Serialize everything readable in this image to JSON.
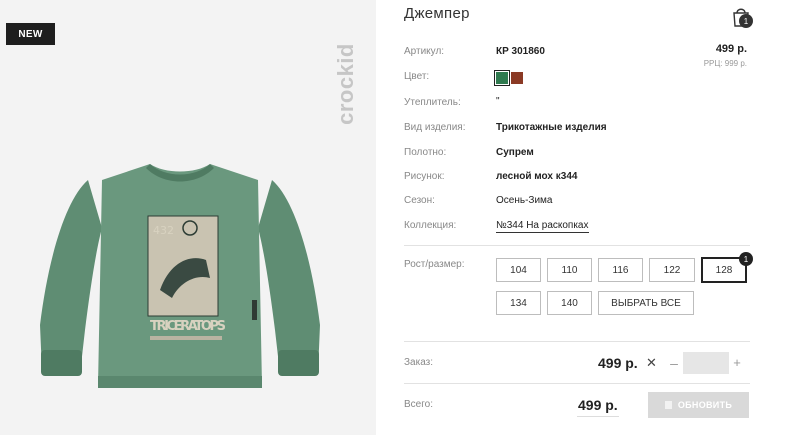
{
  "product": {
    "badge": "NEW",
    "brand": "crockid",
    "print_top": "432",
    "print_main": "TRICERATOPS",
    "title": "Джемпер",
    "cart_count": "1"
  },
  "details": {
    "article_label": "Артикул:",
    "article_value": "КР 301860",
    "color_label": "Цвет:",
    "insulation_label": "Утеплитель:",
    "insulation_value": "\"",
    "type_label": "Вид изделия:",
    "type_value": "Трикотажные изделия",
    "fabric_label": "Полотно:",
    "fabric_value": "Супрем",
    "pattern_label": "Рисунок:",
    "pattern_value": "лесной мох к344",
    "season_label": "Сезон:",
    "season_value": "Осень-Зима",
    "collection_label": "Коллекция:",
    "collection_value": "№344 На раскопках",
    "colors": [
      "#2f7a4f",
      "#8b3a25"
    ]
  },
  "price": {
    "main": "499 р.",
    "rrp": "РРЦ: 999 р."
  },
  "sizes": {
    "label": "Рост/размер:",
    "items": [
      "104",
      "110",
      "116",
      "122",
      "128",
      "134",
      "140"
    ],
    "select_all": "ВЫБРАТЬ ВСЕ",
    "selected": "128",
    "selected_count": "1"
  },
  "order": {
    "label": "Заказ:",
    "price": "499 р.",
    "remove": "✕",
    "minus": "–",
    "plus": "+",
    "qty": ""
  },
  "total": {
    "label": "Всего:",
    "price": "499 р.",
    "button": "ОБНОВИТЬ"
  }
}
